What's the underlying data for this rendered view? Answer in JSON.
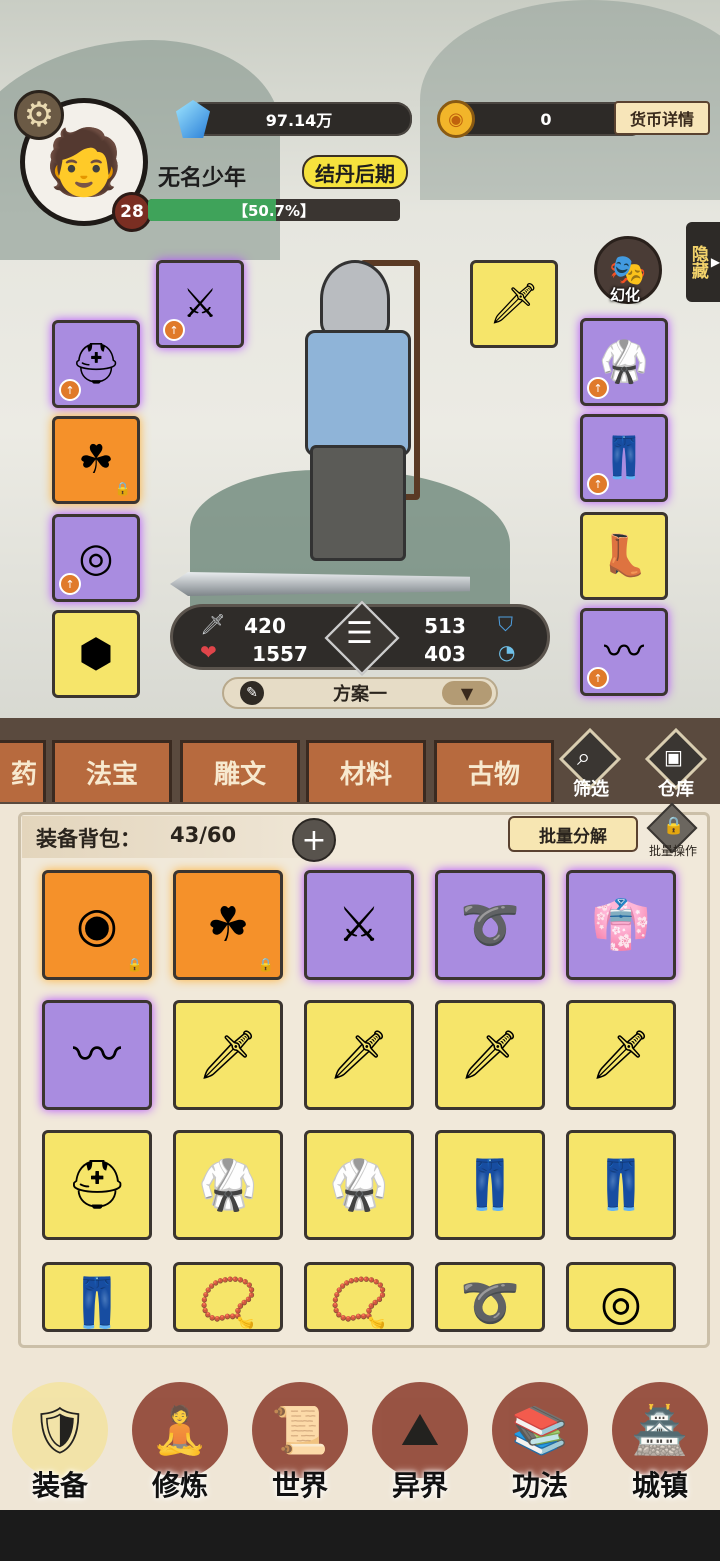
{
  "player": {
    "name": "无名少年",
    "level": "28",
    "realm": "结丹后期",
    "exp_percent_text": "【50.7%】",
    "exp_fraction": 0.507
  },
  "currency": {
    "spirit_stones": "97.14万",
    "gold": "0",
    "details_button": "货币详情"
  },
  "side_buttons": {
    "hide_label": "隐藏",
    "transform_label": "幻化"
  },
  "equipment_slots": {
    "left": [
      {
        "item": "sword",
        "icon": "⚔",
        "rarity": "purple"
      },
      {
        "item": "helmet",
        "icon": "⛑",
        "rarity": "purple"
      },
      {
        "item": "clover-amulet",
        "icon": "☘",
        "rarity": "orange",
        "locked": true
      },
      {
        "item": "ring",
        "icon": "◎",
        "rarity": "purple"
      },
      {
        "item": "pendant",
        "icon": "⬢",
        "rarity": "yellow"
      }
    ],
    "right": [
      {
        "item": "blade",
        "icon": "🗡",
        "rarity": "yellow"
      },
      {
        "item": "armor",
        "icon": "🥋",
        "rarity": "purple"
      },
      {
        "item": "pants",
        "icon": "👖",
        "rarity": "purple"
      },
      {
        "item": "boots",
        "icon": "👢",
        "rarity": "yellow"
      },
      {
        "item": "belt",
        "icon": "〰",
        "rarity": "purple"
      }
    ]
  },
  "stats": {
    "attack": "420",
    "hp": "1557",
    "defense": "513",
    "speed": "403"
  },
  "loadout": {
    "current": "方案一"
  },
  "tabs": {
    "partial": "药",
    "items": [
      "法宝",
      "雕文",
      "材料",
      "古物"
    ],
    "filter_label": "筛选",
    "warehouse_label": "仓库"
  },
  "bag": {
    "title": "装备背包：",
    "count": "43/60",
    "bulk_decompose": "批量分解",
    "bulk_operation": "批量操作",
    "items": [
      {
        "icon": "◉",
        "rarity": "orange",
        "locked": true
      },
      {
        "icon": "☘",
        "rarity": "orange",
        "locked": true
      },
      {
        "icon": "⚔",
        "rarity": "purple"
      },
      {
        "icon": "➰",
        "rarity": "purple"
      },
      {
        "icon": "👘",
        "rarity": "purple"
      },
      {
        "icon": "〰",
        "rarity": "purple"
      },
      {
        "icon": "🗡",
        "rarity": "yellow"
      },
      {
        "icon": "🗡",
        "rarity": "yellow"
      },
      {
        "icon": "🗡",
        "rarity": "yellow"
      },
      {
        "icon": "🗡",
        "rarity": "yellow"
      },
      {
        "icon": "⛑",
        "rarity": "yellow"
      },
      {
        "icon": "🥋",
        "rarity": "yellow"
      },
      {
        "icon": "🥋",
        "rarity": "yellow"
      },
      {
        "icon": "👖",
        "rarity": "yellow"
      },
      {
        "icon": "👖",
        "rarity": "yellow"
      },
      {
        "icon": "👖",
        "rarity": "yellow"
      },
      {
        "icon": "📿",
        "rarity": "yellow"
      },
      {
        "icon": "📿",
        "rarity": "yellow"
      },
      {
        "icon": "➰",
        "rarity": "yellow"
      },
      {
        "icon": "◎",
        "rarity": "yellow"
      }
    ]
  },
  "nav": [
    {
      "label": "装备",
      "icon": "🛡"
    },
    {
      "label": "修炼",
      "icon": "🧘"
    },
    {
      "label": "世界",
      "icon": "📜"
    },
    {
      "label": "异界",
      "icon": "⛰"
    },
    {
      "label": "功法",
      "icon": "📚"
    },
    {
      "label": "城镇",
      "icon": "🏯"
    }
  ],
  "colors": {
    "rarity_yellow": "#f6e56a",
    "rarity_purple": "#a98ce0",
    "rarity_orange": "#f5912a",
    "tab_brown": "#b76a3e",
    "exp_green": "#3fa35a"
  }
}
